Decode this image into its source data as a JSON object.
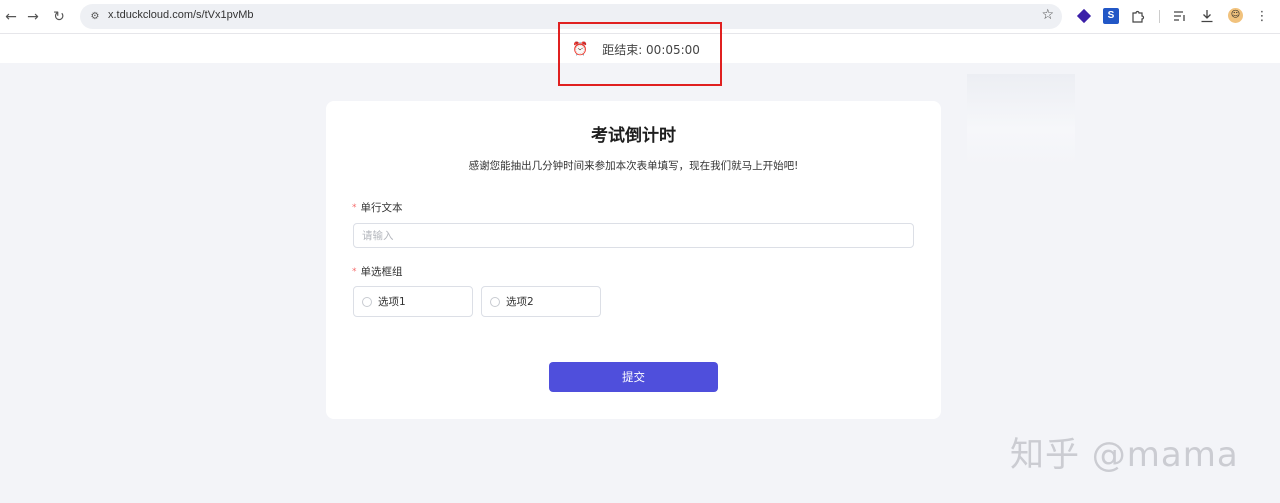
{
  "browser": {
    "back_icon": "arrow-left-icon",
    "forward_icon": "arrow-right-icon",
    "reload_icon": "reload-icon",
    "url": "x.tduckcloud.com/s/tVx1pvMb",
    "extensions": [
      "gem-extension-icon",
      "s-extension-icon",
      "puzzle-extension-icon",
      "reading-list-icon",
      "download-icon",
      "profile-avatar-icon",
      "more-menu-icon"
    ],
    "s_extension_letter": "S"
  },
  "timer": {
    "label": "距结束: 00:05:00",
    "icon": "alarm-clock-icon",
    "highlight_color": "#e02020"
  },
  "form": {
    "title": "考试倒计时",
    "description": "感谢您能抽出几分钟时间来参加本次表单填写，现在我们就马上开始吧!",
    "fields": {
      "text_label": "单行文本",
      "text_placeholder": "请输入",
      "radio_label": "单选框组",
      "radio_options": [
        "选项1",
        "选项2"
      ]
    },
    "required_marker": "*",
    "submit_label": "提交",
    "accent_color": "#4f4fdc"
  },
  "watermark": "知乎 @mama"
}
